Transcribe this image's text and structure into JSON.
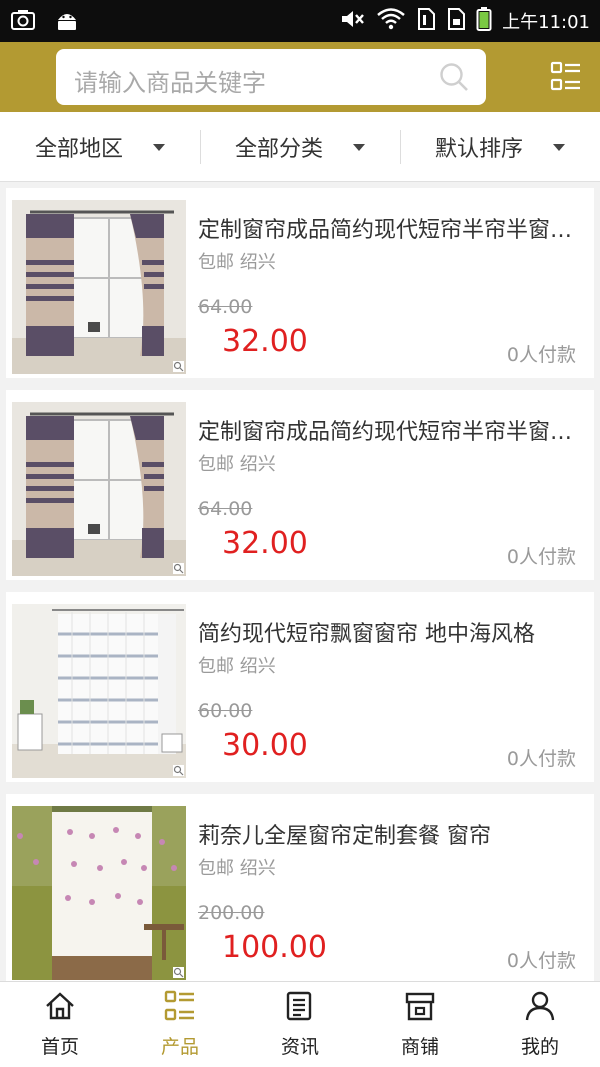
{
  "status_bar": {
    "time": "上午11:01",
    "icons": [
      "screenshot-icon",
      "android-icon",
      "mute-icon",
      "wifi-icon",
      "sim1-icon",
      "sim2-icon",
      "battery-icon"
    ]
  },
  "header": {
    "search_placeholder": "请输入商品关键字",
    "accent_color": "#b39a32"
  },
  "filters": [
    {
      "label": "全部地区"
    },
    {
      "label": "全部分类"
    },
    {
      "label": "默认排序"
    }
  ],
  "products": [
    {
      "title": "定制窗帘成品简约现代短帘半帘半窗卧室",
      "meta": "包邮 绍兴",
      "old_price": "64.00",
      "price": "32.00",
      "paid": "0人付款",
      "image": "purple-striped-curtain"
    },
    {
      "title": "定制窗帘成品简约现代短帘半帘半窗卧室",
      "meta": "包邮 绍兴",
      "old_price": "64.00",
      "price": "32.00",
      "paid": "0人付款",
      "image": "purple-striped-curtain"
    },
    {
      "title": "简约现代短帘飘窗窗帘 地中海风格",
      "meta": "包邮 绍兴",
      "old_price": "60.00",
      "price": "30.00",
      "paid": "0人付款",
      "image": "white-sheer-curtain"
    },
    {
      "title": "莉奈儿全屋窗帘定制套餐 窗帘 ",
      "meta": "包邮 绍兴",
      "old_price": "200.00",
      "price": "100.00",
      "paid": "0人付款",
      "image": "green-floral-curtain"
    }
  ],
  "bottom_nav": [
    {
      "label": "首页",
      "icon": "home-icon",
      "active": false
    },
    {
      "label": "产品",
      "icon": "product-grid-icon",
      "active": true
    },
    {
      "label": "资讯",
      "icon": "news-icon",
      "active": false
    },
    {
      "label": "商铺",
      "icon": "shop-icon",
      "active": false
    },
    {
      "label": "我的",
      "icon": "user-icon",
      "active": false
    }
  ],
  "colors": {
    "price_red": "#e02020",
    "text_gray": "#9a9a9a",
    "active_gold": "#b39a32"
  }
}
